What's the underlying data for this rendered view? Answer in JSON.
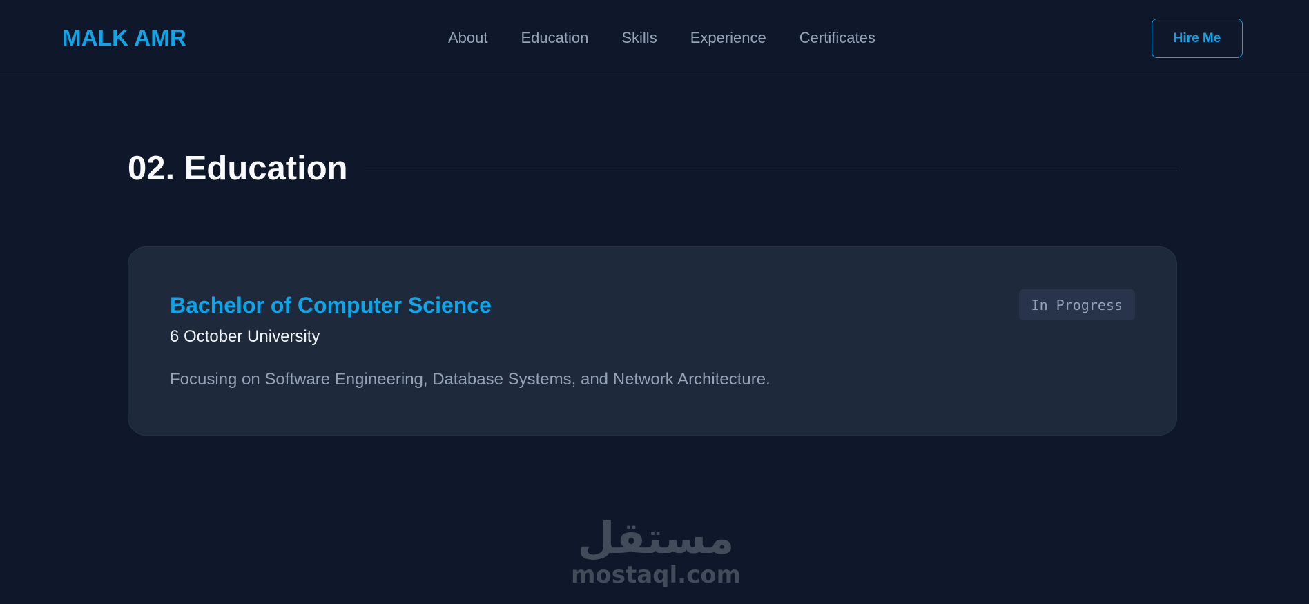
{
  "header": {
    "brand": "MALK AMR",
    "nav": [
      {
        "label": "About"
      },
      {
        "label": "Education"
      },
      {
        "label": "Skills"
      },
      {
        "label": "Experience"
      },
      {
        "label": "Certificates"
      }
    ],
    "cta_label": "Hire Me"
  },
  "section": {
    "title": "02. Education"
  },
  "education": {
    "degree": "Bachelor of Computer Science",
    "school": "6 October University",
    "description": "Focusing on Software Engineering, Database Systems, and Network Architecture.",
    "status": "In Progress"
  },
  "watermark": {
    "arabic": "مستقل",
    "latin": "mostaql.com"
  },
  "colors": {
    "background": "#0f172a",
    "card": "#1e293b",
    "accent": "#0ea5e9",
    "muted_text": "#94a3b8"
  }
}
